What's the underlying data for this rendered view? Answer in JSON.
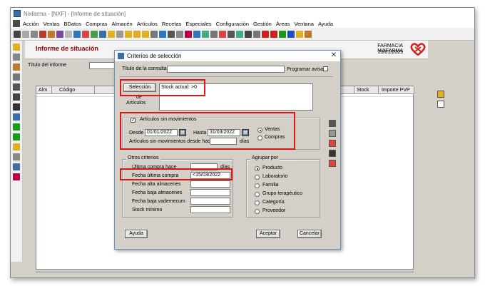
{
  "window": {
    "title": "Nixfarma - [NXF] - [Informe de situación]"
  },
  "menu": [
    "Acción",
    "Ventas",
    "BDatos",
    "Compras",
    "Almacén",
    "Artículos",
    "Recetas",
    "Especiales",
    "Configuración",
    "Gestión",
    "Áreas",
    "Ventana",
    "Ayuda"
  ],
  "background": {
    "title": "Informe de situación",
    "pharmacy": "FARMACIA NIXFARMA",
    "date": "23/01/2023",
    "report_title_label": "Título del informe",
    "columns": {
      "alm": "Alm",
      "codigo": "Código",
      "stock": "Stock",
      "importe": "Importe PVP"
    }
  },
  "dialog": {
    "title": "Criterios de selección",
    "query_title_label": "Título de la consulta:",
    "query_title_value": "",
    "programar_label": "Programar aviso",
    "seleccion_button": "Selección",
    "seleccion_value": "Stock actual: >0",
    "de_label": "de",
    "articulos_label": "Artículos",
    "sin_mov_label": "Artículos sin movimientos",
    "sin_mov_checked": true,
    "desde_label": "Desde",
    "desde_value": "01/01/2022",
    "hasta_label": "Hasta",
    "hasta_value": "31/03/2022",
    "sin_mov_desde_label": "Artículos sin movimientos desde hace",
    "sin_mov_desde_value": "",
    "dias_label": "días",
    "ventas_label": "Ventas",
    "compras_label": "Compras",
    "otros_label": "Otros criterios",
    "ultima_compra_hace_label": "Última compra hace",
    "ultima_compra_hace_value": "",
    "dias2_label": "días",
    "fecha_ultima_compra_label": "Fecha última compra",
    "fecha_ultima_compra_value": "<15/03/2022",
    "fecha_alta_label": "Fecha alta almacenes",
    "fecha_baja_alm_label": "Fecha baja almacenes",
    "fecha_baja_vad_label": "Fecha baja vademecum",
    "stock_minimo_label": "Stock mínimo",
    "agrupar_label": "Agrupar por",
    "agrupar_options": [
      "Producto",
      "Laboratorio",
      "Familia",
      "Grupo terapéutico",
      "Categoría",
      "Proveedor"
    ],
    "agrupar_selected": "Producto",
    "ayuda_button": "Ayuda",
    "aceptar_button": "Aceptar",
    "cancelar_button": "Cancelar"
  },
  "colors": {
    "highlight": "#e01515",
    "title_red": "#8b0000"
  }
}
